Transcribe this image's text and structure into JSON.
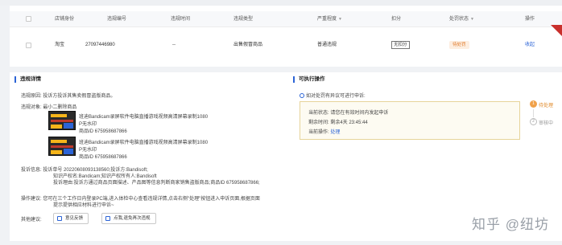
{
  "table": {
    "headers": [
      "店铺身份",
      "违规编号",
      "违规时间",
      "违规类型",
      "严重程度",
      "扣分",
      "处罚状态",
      "操作"
    ],
    "row": {
      "shop": "淘宝",
      "id": "27097446980",
      "time": "--",
      "type": "出售假冒商品",
      "severity": "普通违规",
      "points": "无扣分",
      "status": "待处罚",
      "action": "收起"
    }
  },
  "detail": {
    "title": "违规详情",
    "reason": "违规原因: 投诉方投诉其售卖假冒盗版商品。",
    "object_label": "违规对象: 最小二删除商品",
    "products": [
      {
        "name_l1": "班迪Bandicam录屏软件电脑直播游戏视频高清屏幕录制1080",
        "name_l2": "P无水印",
        "pid": "商品ID 675958687866"
      },
      {
        "name_l1": "班迪Bandicam录屏软件电脑直播游戏视频高清屏幕录制1080",
        "name_l2": "P无水印",
        "pid": "商品ID 675958687866"
      }
    ],
    "info_l1": "投诉信息: 投诉单号 20220608093138560;投诉方:Bandisoft;",
    "info_l2": "知识产权名:Bandicam;知识产权所有人:Bandisoft",
    "info_l3": "投诉理由:投诉方通过商品页面描述、产品图等信息判断商家销售盗版商品;商品ID 675958687866;",
    "op_l1": "操作建议: 您可在三个工作日内登录PC端,进入体检中心查看违规详情,点击右侧\"处理\"按钮进入申诉页面,根据页面",
    "op_l2": "提示提供相应材料进行申诉~",
    "other_label": "其他建议:",
    "btn_feedback": "意见反馈",
    "btn_recheck": "点我,退免再次违规"
  },
  "actions": {
    "title": "可执行操作",
    "q": "如对处罚有异议可进行申诉:",
    "status": "当前状态: 请您在有效时间内发起申诉",
    "remaining": "剩余时间: 剩余4天 23:45:44",
    "current_op_label": "当前操作:",
    "current_op": "处理",
    "steps": [
      "待处理",
      "审核中"
    ],
    "step_nums": [
      "1",
      "2"
    ]
  },
  "watermark": "知乎 @纽坊"
}
